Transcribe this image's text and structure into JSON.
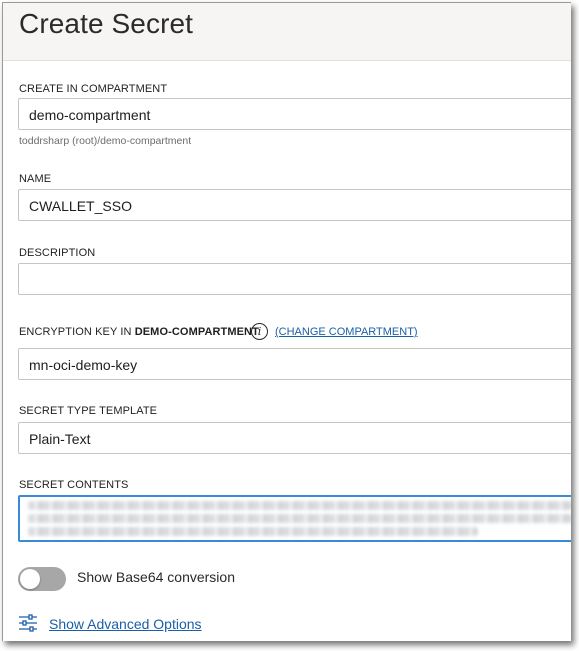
{
  "dialog": {
    "title": "Create Secret"
  },
  "compartment": {
    "label": "CREATE IN COMPARTMENT",
    "value": "demo-compartment",
    "hint": "toddrsharp (root)/demo-compartment"
  },
  "name": {
    "label": "NAME",
    "value": "CWALLET_SSO"
  },
  "description": {
    "label": "DESCRIPTION",
    "value": ""
  },
  "encryption_key": {
    "label_prefix": "ENCRYPTION KEY IN ",
    "label_compartment": "DEMO-COMPARTMENT",
    "change_link": "(CHANGE COMPARTMENT)",
    "info_icon": "info-icon",
    "value": "mn-oci-demo-key"
  },
  "secret_type": {
    "label": "SECRET TYPE TEMPLATE",
    "value": "Plain-Text"
  },
  "secret_contents": {
    "label": "SECRET CONTENTS"
  },
  "base64": {
    "label": "Show Base64 conversion",
    "enabled": false
  },
  "advanced": {
    "link": "Show Advanced Options",
    "icon": "sliders-icon"
  },
  "colors": {
    "accent": "#3b8ad9",
    "link": "#1a5fa8",
    "header_bg": "#f6f5f4",
    "toggle_off": "#a7a7a7"
  }
}
